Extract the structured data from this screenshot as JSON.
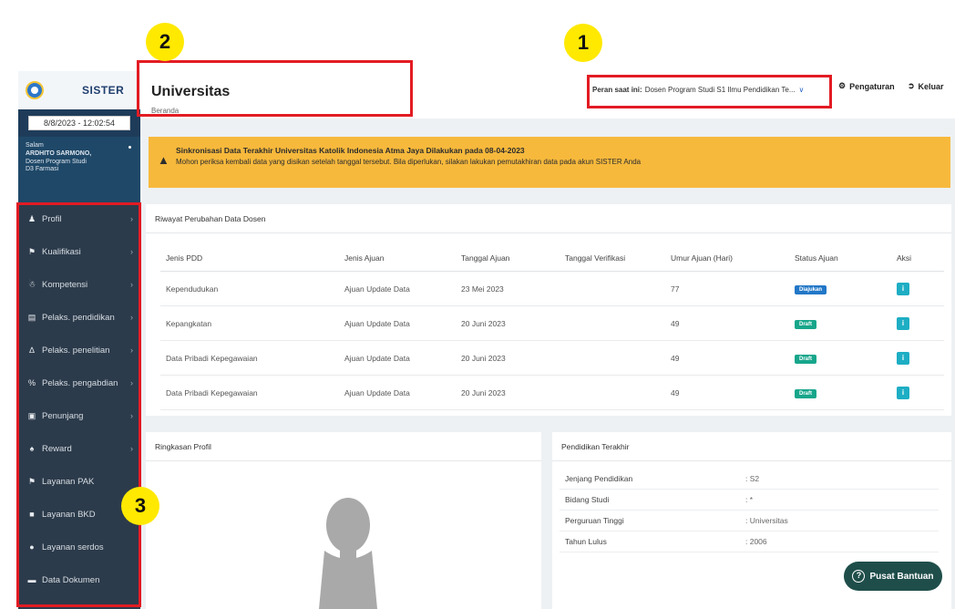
{
  "sidebar": {
    "brand": "SISTER",
    "datetime": "8/8/2023 - 12:02:54",
    "user": {
      "greeting": "Salam",
      "name": "ARDHITO SARMONO,",
      "role_line1": "Dosen Program Studi",
      "role_line2": "D3 Farmasi"
    },
    "items": [
      {
        "label": "Profil",
        "icon": "user-icon"
      },
      {
        "label": "Kualifikasi",
        "icon": "graduation-cap-icon"
      },
      {
        "label": "Kompetensi",
        "icon": "users-icon"
      },
      {
        "label": "Pelaks. pendidikan",
        "icon": "book-icon"
      },
      {
        "label": "Pelaks. penelitian",
        "icon": "flask-icon"
      },
      {
        "label": "Pelaks. pengabdian",
        "icon": "percent-icon"
      },
      {
        "label": "Penunjang",
        "icon": "puzzle-icon"
      },
      {
        "label": "Reward",
        "icon": "trophy-icon"
      },
      {
        "label": "Layanan PAK",
        "icon": "graduation-cap-icon"
      },
      {
        "label": "Layanan BKD",
        "icon": "briefcase-icon"
      },
      {
        "label": "Layanan serdos",
        "icon": "circle-icon"
      },
      {
        "label": "Data Dokumen",
        "icon": "folder-icon"
      }
    ]
  },
  "header": {
    "title": "Universitas",
    "breadcrumb": "Beranda",
    "role_label": "Peran saat ini:",
    "role_value": "Dosen Program Studi S1 Ilmu Pendidikan Te...",
    "settings_label": "Pengaturan",
    "logout_label": "Keluar"
  },
  "alert": {
    "title": "Sinkronisasi Data Terakhir Universitas Katolik Indonesia Atma Jaya Dilakukan pada 08-04-2023",
    "message": "Mohon periksa kembali data yang disikan setelah tanggal tersebut. Bila diperlukan, silakan lakukan pemutakhiran data pada akun SISTER Anda"
  },
  "riwayat": {
    "title": "Riwayat Perubahan Data Dosen",
    "columns": [
      "Jenis PDD",
      "Jenis Ajuan",
      "Tanggal Ajuan",
      "Tanggal Verifikasi",
      "Umur Ajuan (Hari)",
      "Status Ajuan",
      "Aksi"
    ],
    "rows": [
      {
        "jenis_pdd": "Kependudukan",
        "jenis_ajuan": "Ajuan Update Data",
        "tanggal_ajuan": "23 Mei 2023",
        "tanggal_verifikasi": "",
        "umur": "77",
        "status": "Diajukan",
        "status_color": "#2277c7"
      },
      {
        "jenis_pdd": "Kepangkatan",
        "jenis_ajuan": "Ajuan Update Data",
        "tanggal_ajuan": "20 Juni 2023",
        "tanggal_verifikasi": "",
        "umur": "49",
        "status": "Draft",
        "status_color": "#17a68b"
      },
      {
        "jenis_pdd": "Data Pribadi Kepegawaian",
        "jenis_ajuan": "Ajuan Update Data",
        "tanggal_ajuan": "20 Juni 2023",
        "tanggal_verifikasi": "",
        "umur": "49",
        "status": "Draft",
        "status_color": "#17a68b"
      },
      {
        "jenis_pdd": "Data Pribadi Kepegawaian",
        "jenis_ajuan": "Ajuan Update Data",
        "tanggal_ajuan": "20 Juni 2023",
        "tanggal_verifikasi": "",
        "umur": "49",
        "status": "Draft",
        "status_color": "#17a68b"
      }
    ],
    "action_icon": "info-icon"
  },
  "profil": {
    "title": "Ringkasan Profil"
  },
  "pendidikan": {
    "title": "Pendidikan Terakhir",
    "rows": [
      {
        "key": "Jenjang Pendidikan",
        "value": ": S2"
      },
      {
        "key": "Bidang Studi",
        "value": ": *"
      },
      {
        "key": "Perguruan Tinggi",
        "value": ": Universitas"
      },
      {
        "key": "Tahun Lulus",
        "value": ": 2006"
      }
    ]
  },
  "help_button": {
    "label": "Pusat Bantuan",
    "icon": "question-circle-icon"
  },
  "annotations": {
    "markers": [
      "1",
      "2",
      "3"
    ],
    "highlight_color": "#e31b23",
    "marker_color": "#ffe900"
  }
}
